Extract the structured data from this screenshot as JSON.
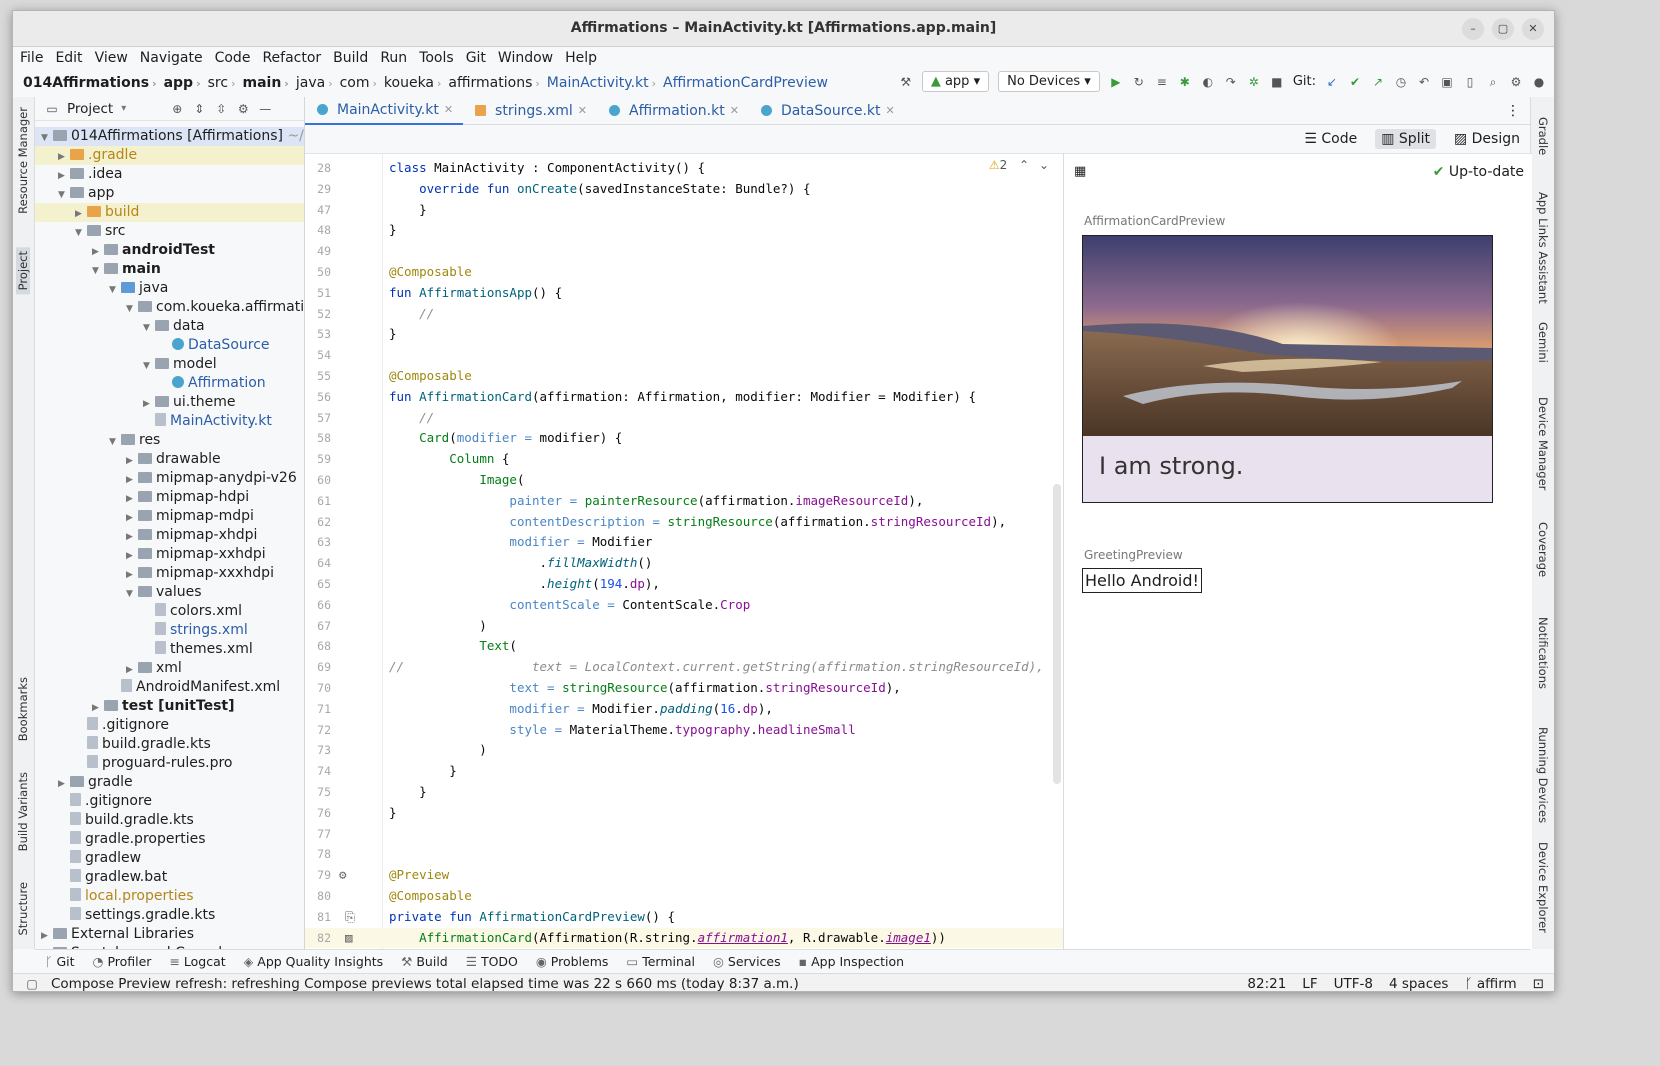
{
  "window": {
    "title": "Affirmations – MainActivity.kt [Affirmations.app.main]",
    "min": "–",
    "max": "▢",
    "close": "✕"
  },
  "menu": [
    "File",
    "Edit",
    "View",
    "Navigate",
    "Code",
    "Refactor",
    "Build",
    "Run",
    "Tools",
    "Git",
    "Window",
    "Help"
  ],
  "breadcrumb": [
    "014Affirmations",
    "app",
    "src",
    "main",
    "java",
    "com",
    "koueka",
    "affirmations",
    "MainActivity.kt",
    "AffirmationCardPreview"
  ],
  "toolbar": {
    "run_config": "app",
    "device": "No Devices",
    "git_label": "Git:"
  },
  "project_panel": {
    "title": "Project",
    "tree": [
      {
        "label": "014Affirmations [Affirmations]",
        "suffix": "~/Id",
        "depth": 0,
        "icon": "folder",
        "open": true,
        "style": "sel"
      },
      {
        "label": ".gradle",
        "depth": 1,
        "icon": "orange",
        "open": false,
        "style": "hl",
        "color": "orange"
      },
      {
        "label": ".idea",
        "depth": 1,
        "icon": "folder",
        "open": false
      },
      {
        "label": "app",
        "depth": 1,
        "icon": "folder",
        "open": true
      },
      {
        "label": "build",
        "depth": 2,
        "icon": "orange",
        "open": false,
        "style": "hl",
        "color": "orange"
      },
      {
        "label": "src",
        "depth": 2,
        "icon": "folder",
        "open": true
      },
      {
        "label": "androidTest",
        "depth": 3,
        "icon": "folder",
        "open": false,
        "bold": true
      },
      {
        "label": "main",
        "depth": 3,
        "icon": "folder",
        "open": true,
        "bold": true
      },
      {
        "label": "java",
        "depth": 4,
        "icon": "blue",
        "open": true
      },
      {
        "label": "com.koueka.affirmatio",
        "depth": 5,
        "icon": "folder",
        "open": true
      },
      {
        "label": "data",
        "depth": 6,
        "icon": "folder",
        "open": true
      },
      {
        "label": "DataSource",
        "depth": 7,
        "icon": "kt",
        "color": "blue"
      },
      {
        "label": "model",
        "depth": 6,
        "icon": "folder",
        "open": true
      },
      {
        "label": "Affirmation",
        "depth": 7,
        "icon": "kt",
        "color": "blue"
      },
      {
        "label": "ui.theme",
        "depth": 6,
        "icon": "folder",
        "open": false
      },
      {
        "label": "MainActivity.kt",
        "depth": 6,
        "icon": "file",
        "color": "blue"
      },
      {
        "label": "res",
        "depth": 4,
        "icon": "folder",
        "open": true
      },
      {
        "label": "drawable",
        "depth": 5,
        "icon": "folder",
        "open": false
      },
      {
        "label": "mipmap-anydpi-v26",
        "depth": 5,
        "icon": "folder",
        "open": false
      },
      {
        "label": "mipmap-hdpi",
        "depth": 5,
        "icon": "folder",
        "open": false
      },
      {
        "label": "mipmap-mdpi",
        "depth": 5,
        "icon": "folder",
        "open": false
      },
      {
        "label": "mipmap-xhdpi",
        "depth": 5,
        "icon": "folder",
        "open": false
      },
      {
        "label": "mipmap-xxhdpi",
        "depth": 5,
        "icon": "folder",
        "open": false
      },
      {
        "label": "mipmap-xxxhdpi",
        "depth": 5,
        "icon": "folder",
        "open": false
      },
      {
        "label": "values",
        "depth": 5,
        "icon": "folder",
        "open": true
      },
      {
        "label": "colors.xml",
        "depth": 6,
        "icon": "file"
      },
      {
        "label": "strings.xml",
        "depth": 6,
        "icon": "file",
        "color": "blue"
      },
      {
        "label": "themes.xml",
        "depth": 6,
        "icon": "file"
      },
      {
        "label": "xml",
        "depth": 5,
        "icon": "folder",
        "open": false
      },
      {
        "label": "AndroidManifest.xml",
        "depth": 4,
        "icon": "file"
      },
      {
        "label": "test [unitTest]",
        "depth": 3,
        "icon": "folder",
        "open": false,
        "bold": true
      },
      {
        "label": ".gitignore",
        "depth": 2,
        "icon": "file"
      },
      {
        "label": "build.gradle.kts",
        "depth": 2,
        "icon": "file"
      },
      {
        "label": "proguard-rules.pro",
        "depth": 2,
        "icon": "file"
      },
      {
        "label": "gradle",
        "depth": 1,
        "icon": "folder",
        "open": false
      },
      {
        "label": ".gitignore",
        "depth": 1,
        "icon": "file"
      },
      {
        "label": "build.gradle.kts",
        "depth": 1,
        "icon": "file"
      },
      {
        "label": "gradle.properties",
        "depth": 1,
        "icon": "file"
      },
      {
        "label": "gradlew",
        "depth": 1,
        "icon": "file"
      },
      {
        "label": "gradlew.bat",
        "depth": 1,
        "icon": "file"
      },
      {
        "label": "local.properties",
        "depth": 1,
        "icon": "file",
        "color": "orange"
      },
      {
        "label": "settings.gradle.kts",
        "depth": 1,
        "icon": "file"
      },
      {
        "label": "External Libraries",
        "depth": 0,
        "icon": "folder",
        "open": false
      },
      {
        "label": "Scratches and Consoles",
        "depth": 0,
        "icon": "folder",
        "open": false
      }
    ]
  },
  "tabs": [
    "MainActivity.kt",
    "strings.xml",
    "Affirmation.kt",
    "DataSource.kt"
  ],
  "view_modes": [
    "Code",
    "Split",
    "Design"
  ],
  "left_tools": [
    "Resource Manager",
    "Project",
    "Bookmarks",
    "Build Variants",
    "Structure"
  ],
  "right_tools": [
    "Gradle",
    "App Links Assistant",
    "Gemini",
    "Device Manager",
    "Coverage",
    "Notifications",
    "Running Devices",
    "Device Explorer"
  ],
  "editor": {
    "warnings": "2",
    "lines": [
      {
        "n": "28",
        "t": [
          [
            "kw",
            "class "
          ],
          [
            "",
            "MainActivity : ComponentActivity() {"
          ]
        ]
      },
      {
        "n": "29",
        "t": [
          [
            "",
            "    "
          ],
          [
            "kw",
            "override fun "
          ],
          [
            "fn",
            "onCreate"
          ],
          [
            "",
            "(savedInstanceState: Bundle?) {"
          ]
        ]
      },
      {
        "n": "47",
        "t": [
          [
            "",
            "    }"
          ]
        ]
      },
      {
        "n": "48",
        "t": [
          [
            "",
            "}"
          ]
        ]
      },
      {
        "n": "49",
        "t": [
          [
            "",
            ""
          ]
        ]
      },
      {
        "n": "50",
        "t": [
          [
            "ann",
            "@Composable"
          ]
        ]
      },
      {
        "n": "51",
        "t": [
          [
            "kw",
            "fun "
          ],
          [
            "fn",
            "AffirmationsApp"
          ],
          [
            "",
            "() {"
          ]
        ]
      },
      {
        "n": "52",
        "t": [
          [
            "cmt",
            "    //"
          ]
        ]
      },
      {
        "n": "53",
        "t": [
          [
            "",
            "}"
          ]
        ]
      },
      {
        "n": "54",
        "t": [
          [
            "",
            ""
          ]
        ]
      },
      {
        "n": "55",
        "t": [
          [
            "ann",
            "@Composable"
          ]
        ]
      },
      {
        "n": "56",
        "t": [
          [
            "kw",
            "fun "
          ],
          [
            "fn",
            "AffirmationCard"
          ],
          [
            "",
            "(affirmation: Affirmation, modifier: Modifier = Modifier) {"
          ]
        ]
      },
      {
        "n": "57",
        "t": [
          [
            "cmt",
            "    //"
          ]
        ]
      },
      {
        "n": "58",
        "t": [
          [
            "",
            "    "
          ],
          [
            "str",
            "Card"
          ],
          [
            "",
            "("
          ],
          [
            "param",
            "modifier = "
          ],
          [
            "",
            "modifier) {"
          ]
        ]
      },
      {
        "n": "59",
        "t": [
          [
            "",
            "        "
          ],
          [
            "str",
            "Column "
          ],
          [
            "",
            "{"
          ]
        ]
      },
      {
        "n": "60",
        "t": [
          [
            "",
            "            "
          ],
          [
            "str",
            "Image"
          ],
          [
            "",
            "("
          ]
        ]
      },
      {
        "n": "61",
        "t": [
          [
            "",
            "                "
          ],
          [
            "param",
            "painter = "
          ],
          [
            "str",
            "painterResource"
          ],
          [
            "",
            "(affirmation."
          ],
          [
            "prop",
            "imageResourceId"
          ],
          [
            "",
            "),"
          ]
        ]
      },
      {
        "n": "62",
        "t": [
          [
            "",
            "                "
          ],
          [
            "param",
            "contentDescription = "
          ],
          [
            "str",
            "stringResource"
          ],
          [
            "",
            "(affirmation."
          ],
          [
            "prop",
            "stringResourceId"
          ],
          [
            "",
            "),"
          ]
        ]
      },
      {
        "n": "63",
        "t": [
          [
            "",
            "                "
          ],
          [
            "param",
            "modifier = "
          ],
          [
            "",
            "Modifier"
          ]
        ]
      },
      {
        "n": "64",
        "t": [
          [
            "",
            "                    ."
          ],
          [
            "fn it",
            "fillMaxWidth"
          ],
          [
            "",
            "()"
          ]
        ]
      },
      {
        "n": "65",
        "t": [
          [
            "",
            "                    ."
          ],
          [
            "fn it",
            "height"
          ],
          [
            "",
            "("
          ],
          [
            "num",
            "194"
          ],
          [
            "",
            "."
          ],
          [
            "prop",
            "dp"
          ],
          [
            "",
            "),"
          ]
        ]
      },
      {
        "n": "66",
        "t": [
          [
            "",
            "                "
          ],
          [
            "param",
            "contentScale = "
          ],
          [
            "",
            "ContentScale."
          ],
          [
            "prop",
            "Crop"
          ]
        ]
      },
      {
        "n": "67",
        "t": [
          [
            "",
            "            )"
          ]
        ]
      },
      {
        "n": "68",
        "t": [
          [
            "",
            "            "
          ],
          [
            "str",
            "Text"
          ],
          [
            "",
            "("
          ]
        ]
      },
      {
        "n": "69",
        "t": [
          [
            "cmt",
            "//                 text = LocalContext.current.getString(affirmation.stringResourceId),"
          ]
        ]
      },
      {
        "n": "70",
        "t": [
          [
            "",
            "                "
          ],
          [
            "param",
            "text = "
          ],
          [
            "str",
            "stringResource"
          ],
          [
            "",
            "(affirmation."
          ],
          [
            "prop",
            "stringResourceId"
          ],
          [
            "",
            "),"
          ]
        ]
      },
      {
        "n": "71",
        "t": [
          [
            "",
            "                "
          ],
          [
            "param",
            "modifier = "
          ],
          [
            "",
            "Modifier."
          ],
          [
            "fn it",
            "padding"
          ],
          [
            "",
            "("
          ],
          [
            "num",
            "16"
          ],
          [
            "",
            "."
          ],
          [
            "prop",
            "dp"
          ],
          [
            "",
            "),"
          ]
        ]
      },
      {
        "n": "72",
        "t": [
          [
            "",
            "                "
          ],
          [
            "param",
            "style = "
          ],
          [
            "",
            "MaterialTheme."
          ],
          [
            "prop",
            "typography"
          ],
          [
            "",
            "."
          ],
          [
            "prop",
            "headlineSmall"
          ]
        ]
      },
      {
        "n": "73",
        "t": [
          [
            "",
            "            )"
          ]
        ]
      },
      {
        "n": "74",
        "t": [
          [
            "",
            "        }"
          ]
        ]
      },
      {
        "n": "75",
        "t": [
          [
            "",
            "    }"
          ]
        ]
      },
      {
        "n": "76",
        "t": [
          [
            "",
            "}"
          ]
        ]
      },
      {
        "n": "77",
        "t": [
          [
            "",
            ""
          ]
        ]
      },
      {
        "n": "78",
        "t": [
          [
            "",
            ""
          ]
        ]
      },
      {
        "n": "79",
        "t": [
          [
            "ann",
            "@Preview"
          ]
        ]
      },
      {
        "n": "80",
        "t": [
          [
            "ann",
            "@Composable"
          ]
        ]
      },
      {
        "n": "81",
        "t": [
          [
            "kw",
            "private fun "
          ],
          [
            "fn",
            "AffirmationCardPreview"
          ],
          [
            "",
            "() {"
          ]
        ]
      },
      {
        "n": "82",
        "t": [
          [
            "",
            "    "
          ],
          [
            "str",
            "AffirmationCard"
          ],
          [
            "",
            "(Affirmation(R.string."
          ],
          [
            "prop it ul",
            "affirmation1"
          ],
          [
            "",
            ", R.drawable."
          ],
          [
            "prop it ul",
            "image1"
          ],
          [
            "",
            "))"
          ]
        ]
      },
      {
        "n": "83",
        "t": [
          [
            "",
            ""
          ]
        ]
      }
    ]
  },
  "preview": {
    "status": "Up-to-date",
    "card_preview_label": "AffirmationCardPreview",
    "card_text": "I am strong.",
    "greeting_preview_label": "GreetingPreview",
    "greeting_text": "Hello Android!"
  },
  "bottom_tools": [
    "Git",
    "Profiler",
    "Logcat",
    "App Quality Insights",
    "Build",
    "TODO",
    "Problems",
    "Terminal",
    "Services",
    "App Inspection"
  ],
  "status": {
    "message": "Compose Preview refresh: refreshing Compose previews total elapsed time was 22 s 660 ms (today 8:37 a.m.)",
    "position": "82:21",
    "line_sep": "LF",
    "encoding": "UTF-8",
    "indent": "4 spaces",
    "branch": "affirm"
  },
  "colors": {
    "accent": "#3874d8",
    "keyword": "#0033b3",
    "annotation": "#9e880d"
  }
}
